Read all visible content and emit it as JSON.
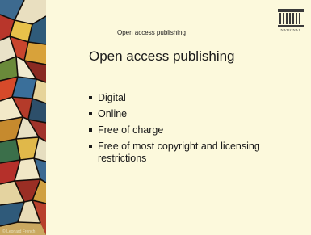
{
  "slide": {
    "header": "Open access publishing",
    "title": "Open access publishing",
    "bullets": [
      "Digital",
      "Online",
      "Free of charge",
      "Free of most copyright and licensing restrictions"
    ],
    "credit": "© Leonard French",
    "logo_label": "NATIONAL"
  },
  "colors": {
    "background": "#fcf9dc",
    "text": "#1a1a1a"
  },
  "icons": {
    "logo": "library-building-icon"
  }
}
